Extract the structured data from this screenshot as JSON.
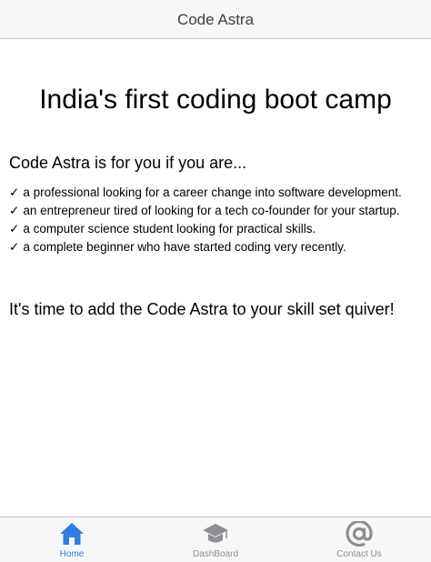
{
  "nav": {
    "title": "Code Astra"
  },
  "main": {
    "headline": "India's first coding boot camp",
    "subhead": "Code Astra is for you if you are...",
    "check_glyph": "✓",
    "features": [
      "a professional looking for a career change into software development.",
      "an entrepreneur tired of looking for a tech co-founder for your startup.",
      "a computer science student looking for practical skills.",
      "a complete beginner who have started coding very recently."
    ],
    "closing": "It's time to add the Code Astra to your skill set quiver!"
  },
  "tabs": [
    {
      "label": "Home",
      "icon": "home-icon",
      "active": true
    },
    {
      "label": "DashBoard",
      "icon": "graduation-cap-icon",
      "active": false
    },
    {
      "label": "Contact Us",
      "icon": "at-sign-icon",
      "active": false
    }
  ],
  "colors": {
    "active": "#2f7de1",
    "inactive": "#8e8e93",
    "bar_bg": "#f7f7f7"
  }
}
